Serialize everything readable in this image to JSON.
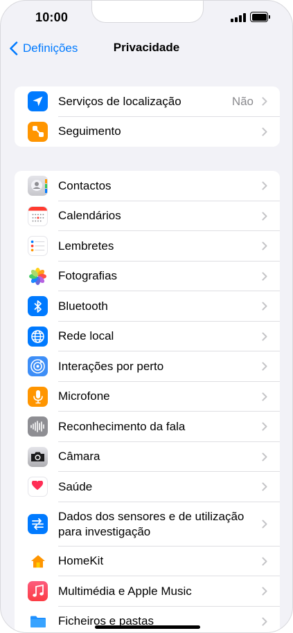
{
  "status_bar": {
    "time": "10:00"
  },
  "nav": {
    "back_label": "Definições",
    "title": "Privacidade"
  },
  "group1": [
    {
      "label": "Serviços de localização",
      "value": "Não",
      "icon": "location-arrow-icon",
      "color": "#007aff"
    },
    {
      "label": "Seguimento",
      "value": "",
      "icon": "tracking-icon",
      "color": "#ff9500"
    }
  ],
  "group2": [
    {
      "label": "Contactos",
      "icon": "contacts-icon",
      "color": "#d1d1d6"
    },
    {
      "label": "Calendários",
      "icon": "calendar-icon",
      "color": "#ffffff"
    },
    {
      "label": "Lembretes",
      "icon": "reminders-icon",
      "color": "#ffffff"
    },
    {
      "label": "Fotografias",
      "icon": "photos-icon",
      "color": "#ffffff"
    },
    {
      "label": "Bluetooth",
      "icon": "bluetooth-icon",
      "color": "#007aff"
    },
    {
      "label": "Rede local",
      "icon": "globe-icon",
      "color": "#007aff"
    },
    {
      "label": "Interações por perto",
      "icon": "nearby-interactions-icon",
      "color": "#3d8ef7"
    },
    {
      "label": "Microfone",
      "icon": "microphone-icon",
      "color": "#ff9500"
    },
    {
      "label": "Reconhecimento da fala",
      "icon": "speech-waveform-icon",
      "color": "#8e8e93"
    },
    {
      "label": "Câmara",
      "icon": "camera-icon",
      "color": "#c7c7cc"
    },
    {
      "label": "Saúde",
      "icon": "health-heart-icon",
      "color": "#ffffff"
    },
    {
      "label": "Dados dos sensores e de utilização para investigação",
      "icon": "research-icon",
      "color": "#007aff"
    },
    {
      "label": "HomeKit",
      "icon": "home-icon",
      "color": "#ffffff"
    },
    {
      "label": "Multimédia e Apple Music",
      "icon": "music-note-icon",
      "color": "#fc3c44"
    },
    {
      "label": "Ficheiros e pastas",
      "icon": "folder-icon",
      "color": "#ffffff"
    }
  ]
}
